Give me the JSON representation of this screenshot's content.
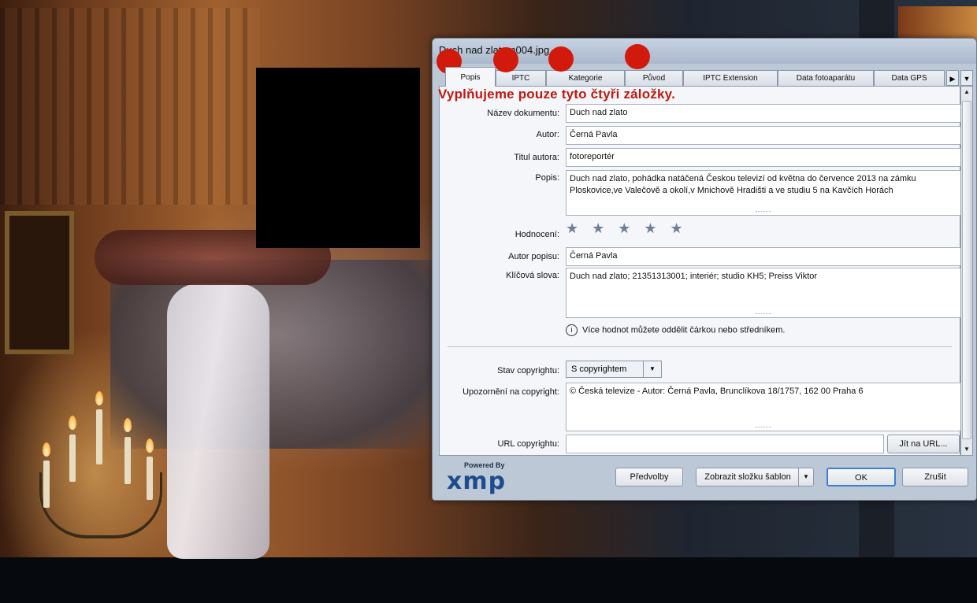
{
  "dialog": {
    "title": "Duch nad zlatem004.jpg",
    "tabs": [
      {
        "label": "Popis"
      },
      {
        "label": "IPTC"
      },
      {
        "label": "Kategorie"
      },
      {
        "label": "Původ"
      },
      {
        "label": "IPTC Extension"
      },
      {
        "label": "Data fotoaparátu"
      },
      {
        "label": "Data GPS"
      }
    ],
    "tab_scroll_right_icon": "triangle-right",
    "tab_menu_icon": "triangle-down",
    "active_tab": "Popis"
  },
  "annotation": {
    "banner_text": "Vyplňujeme pouze  tyto čtyři záložky.",
    "color": "#d21a0c"
  },
  "form": {
    "nazev": {
      "label": "Název dokumentu:",
      "value": "Duch nad zlato"
    },
    "autor": {
      "label": "Autor:",
      "value": "Černá Pavla"
    },
    "titul": {
      "label": "Titul autora:",
      "value": "fotoreportér"
    },
    "popis": {
      "label": "Popis:",
      "value": "Duch nad zlato, pohádka natáčená Českou televizí od května do července 2013 na zámku Ploskovice,ve Valečově a okolí,v Mnichově Hradišti a ve studiu 5 na Kavčích Horách"
    },
    "hodnoceni": {
      "label": "Hodnocení:",
      "stars": "★ ★ ★ ★ ★",
      "rating": 0,
      "max": 5
    },
    "autor_popisu": {
      "label": "Autor popisu:",
      "value": "Černá Pavla"
    },
    "klicova_slova": {
      "label": "Klíčová slova:",
      "value": "Duch nad zlato; 21351313001; interiér; studio KH5; Preiss Viktor"
    },
    "hint": "Více hodnot můžete oddělit čárkou nebo středníkem.",
    "stav_copyrightu": {
      "label": "Stav copyrightu:",
      "value": "S copyrightem"
    },
    "upozorneni": {
      "label": "Upozornění na copyright:",
      "value": "© Česká televize - Autor: Černá Pavla, Brunclíkova 18/1757, 162 00 Praha 6"
    },
    "url": {
      "label": "URL copyrightu:",
      "value": "",
      "button": "Jít na URL..."
    }
  },
  "footer": {
    "powered_by": "Powered By",
    "logo": "xmp",
    "predvolby": "Předvolby",
    "zobrazit": "Zobrazit složku šablon",
    "ok": "OK",
    "zrusit": "Zrušit"
  }
}
